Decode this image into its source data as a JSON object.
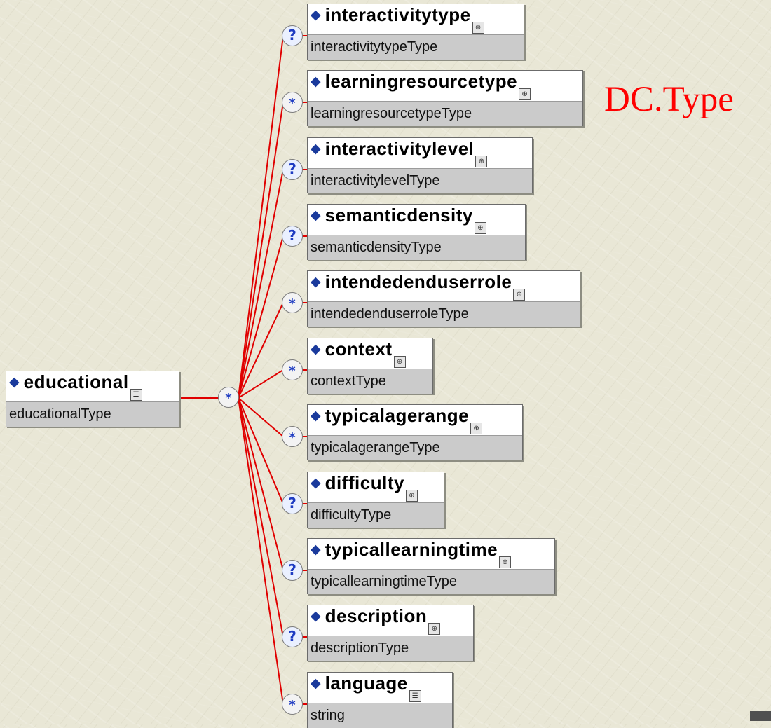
{
  "root": {
    "name": "educational",
    "type": "educationalType",
    "badge_icon": "sequence-icon"
  },
  "compositor": {
    "symbol": "*"
  },
  "children": [
    {
      "name": "interactivitytype",
      "type": "interactivitytypeType",
      "cardinality": "?"
    },
    {
      "name": "learningresourcetype",
      "type": "learningresourcetypeType",
      "cardinality": "*"
    },
    {
      "name": "interactivitylevel",
      "type": "interactivitylevelType",
      "cardinality": "?"
    },
    {
      "name": "semanticdensity",
      "type": "semanticdensityType",
      "cardinality": "?"
    },
    {
      "name": "intendedenduserrole",
      "type": "intendedenduserroleType",
      "cardinality": "*"
    },
    {
      "name": "context",
      "type": "contextType",
      "cardinality": "*"
    },
    {
      "name": "typicalagerange",
      "type": "typicalagerangeType",
      "cardinality": "*"
    },
    {
      "name": "difficulty",
      "type": "difficultyType",
      "cardinality": "?"
    },
    {
      "name": "typicallearningtime",
      "type": "typicallearningtimeType",
      "cardinality": "?"
    },
    {
      "name": "description",
      "type": "descriptionType",
      "cardinality": "?"
    },
    {
      "name": "language",
      "type": "string",
      "cardinality": "*"
    }
  ],
  "annotation": {
    "text": "DC.Type"
  },
  "colors": {
    "connector": "#e00000",
    "background": "#e9e7d6",
    "annotation": "#ff0000",
    "diamond": "#1a3a9c"
  }
}
